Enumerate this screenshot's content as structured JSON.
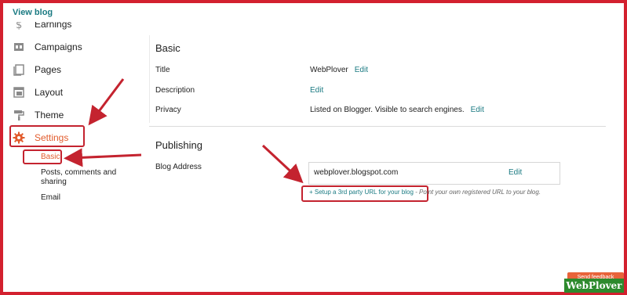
{
  "sidebar": {
    "view_blog": "View blog",
    "items": [
      {
        "label": "Earnings",
        "icon": "dollar-icon"
      },
      {
        "label": "Campaigns",
        "icon": "campaigns-icon"
      },
      {
        "label": "Pages",
        "icon": "pages-icon"
      },
      {
        "label": "Layout",
        "icon": "layout-icon"
      },
      {
        "label": "Theme",
        "icon": "paint-roller-icon"
      },
      {
        "label": "Settings",
        "icon": "gear-icon"
      }
    ],
    "sub_items": [
      {
        "label": "Basic"
      },
      {
        "label": "Posts, comments and sharing"
      },
      {
        "label": "Email"
      }
    ]
  },
  "basic": {
    "heading": "Basic",
    "title_label": "Title",
    "title_value": "WebPlover",
    "description_label": "Description",
    "privacy_label": "Privacy",
    "privacy_value": "Listed on Blogger. Visible to search engines.",
    "edit": "Edit"
  },
  "publishing": {
    "heading": "Publishing",
    "blog_address_label": "Blog Address",
    "blog_address_value": "webplover.blogspot.com",
    "edit": "Edit",
    "setup_link": "+ Setup a 3rd party URL for your blog",
    "setup_hint": " - Point your own registered URL to your blog."
  },
  "footer": {
    "feedback": "Send feedback",
    "brand": "WebPlover"
  },
  "colors": {
    "accent": "#e25c2d",
    "link": "#1a7a82",
    "annotation": "#c4232f",
    "brand_bg": "#2d8a2d"
  }
}
